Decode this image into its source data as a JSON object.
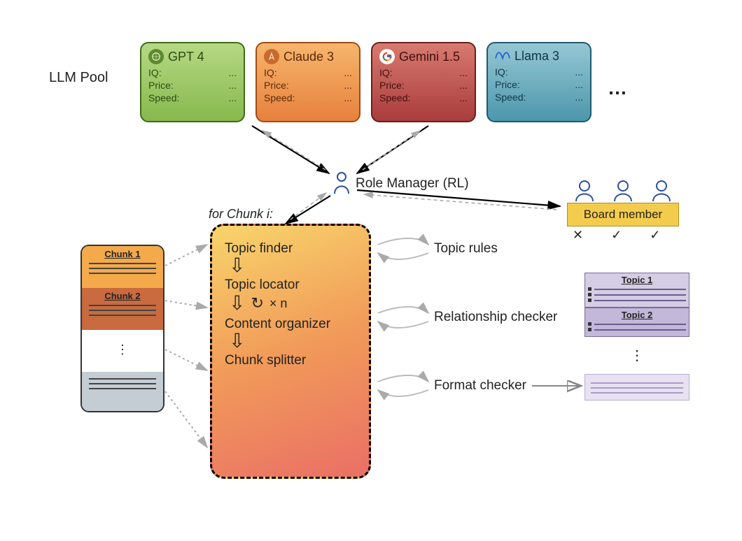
{
  "section_label": "LLM Pool",
  "pool_ellipsis": "…",
  "cards": {
    "gpt": {
      "name": "GPT 4",
      "iq_label": "IQ:",
      "iq_val": "...",
      "price_label": "Price:",
      "price_val": "...",
      "speed_label": "Speed:",
      "speed_val": "..."
    },
    "claude": {
      "name": "Claude 3",
      "iq_label": "IQ:",
      "iq_val": "...",
      "price_label": "Price:",
      "price_val": "...",
      "speed_label": "Speed:",
      "speed_val": "..."
    },
    "gemini": {
      "name": "Gemini 1.5",
      "iq_label": "IQ:",
      "iq_val": "...",
      "price_label": "Price:",
      "price_val": "...",
      "speed_label": "Speed:",
      "speed_val": "..."
    },
    "llama": {
      "name": "Llama 3",
      "iq_label": "IQ:",
      "iq_val": "...",
      "price_label": "Price:",
      "price_val": "...",
      "speed_label": "Speed:",
      "speed_val": "..."
    }
  },
  "role_manager": "Role Manager (RL)",
  "for_chunk_label": "for Chunk i:",
  "proc": {
    "step1": "Topic finder",
    "step2": "Topic locator",
    "step3": "Content organizer",
    "step4": "Chunk splitter",
    "loop_label": "× n"
  },
  "checkers": {
    "rules": "Topic rules",
    "rel": "Relationship checker",
    "fmt": "Format checker"
  },
  "board": {
    "label": "Board member",
    "votes": [
      "✕",
      "✓",
      "✓"
    ]
  },
  "doc": {
    "c1": "Chunk 1",
    "c2": "Chunk 2"
  },
  "topics": {
    "t1": "Topic 1",
    "t2": "Topic 2"
  },
  "out_vdots": "⋮"
}
